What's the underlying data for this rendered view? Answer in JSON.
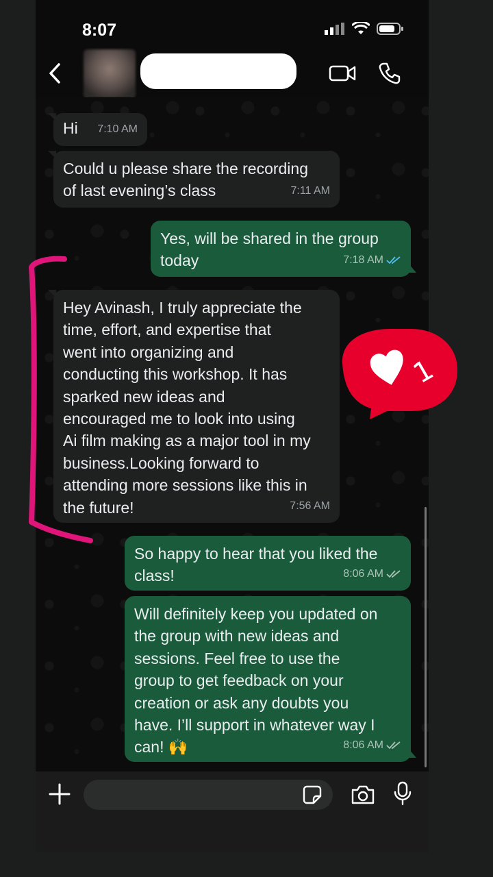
{
  "status_bar": {
    "time": "8:07"
  },
  "header": {
    "contact_name": ""
  },
  "messages": [
    {
      "direction": "in",
      "text": "Hi",
      "time": "7:10 AM"
    },
    {
      "direction": "in",
      "text": "Could u please share the recording\nof last evening’s class",
      "time": "7:11 AM"
    },
    {
      "direction": "out",
      "text": "Yes, will be shared in the group\ntoday",
      "time": "7:18 AM",
      "status": "read"
    },
    {
      "direction": "in",
      "text": "Hey Avinash, I truly appreciate the\ntime, effort, and expertise that\nwent into organizing and\nconducting this workshop. It has\nsparked new ideas and\nencouraged me to look into using\nAi film making as a major tool in my\nbusiness.Looking forward to\nattending more sessions like this in\nthe future!",
      "time": "7:56 AM"
    },
    {
      "direction": "out",
      "text": "So happy to hear that you liked the\nclass!",
      "time": "8:06 AM",
      "status": "delivered"
    },
    {
      "direction": "out",
      "text": "Will definitely keep you updated on\nthe group with new ideas and\nsessions. Feel free to use the\ngroup to get feedback on your\ncreation or ask any doubts you\nhave. I’ll support in whatever way I\ncan! 🙌",
      "time": "8:06 AM",
      "status": "delivered"
    }
  ],
  "reaction_badge": {
    "icon": "heart-icon",
    "count": "1",
    "color": "#e8002d"
  },
  "annotation": {
    "color": "#e0157a"
  },
  "input": {
    "placeholder": ""
  },
  "colors": {
    "incoming": "#1f2121",
    "outgoing": "#1a5b3c",
    "read_tick": "#53bdeb"
  }
}
